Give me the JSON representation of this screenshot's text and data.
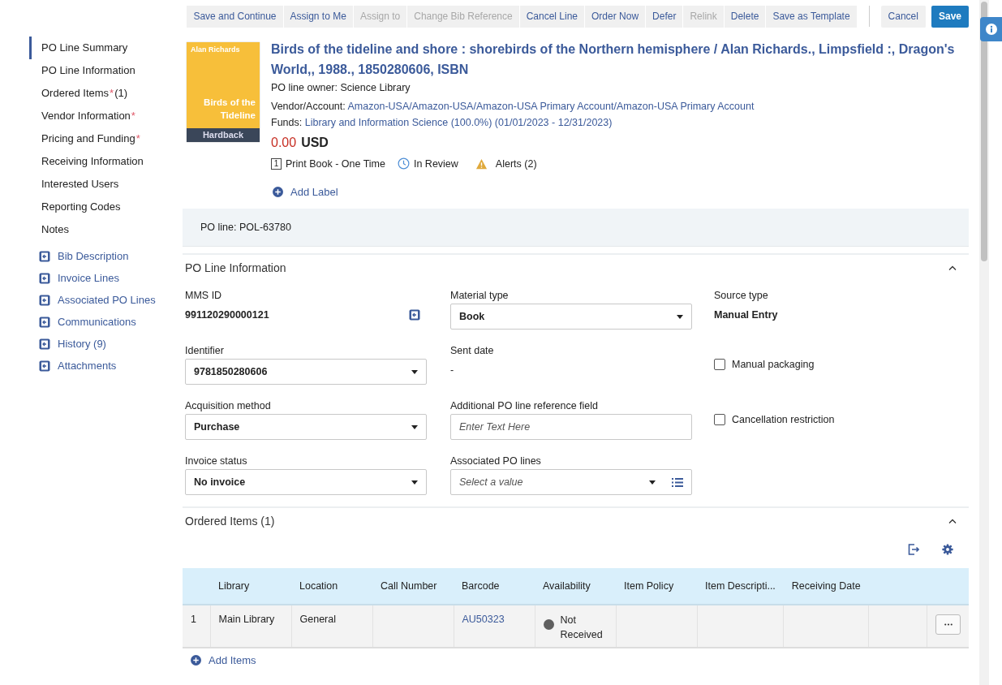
{
  "toolbar": {
    "buttons": [
      {
        "label": "Save and Continue",
        "disabled": false
      },
      {
        "label": "Assign to Me",
        "disabled": false
      },
      {
        "label": "Assign to",
        "disabled": true
      },
      {
        "label": "Change Bib Reference",
        "disabled": true
      },
      {
        "label": "Cancel Line",
        "disabled": false
      },
      {
        "label": "Order Now",
        "disabled": false
      },
      {
        "label": "Defer",
        "disabled": false
      },
      {
        "label": "Relink",
        "disabled": true
      },
      {
        "label": "Delete",
        "disabled": false
      },
      {
        "label": "Save as Template",
        "disabled": false
      }
    ],
    "cancel": "Cancel",
    "save": "Save"
  },
  "nav": {
    "sections": [
      {
        "label": "PO Line Summary",
        "selected": true
      },
      {
        "label": "PO Line Information",
        "selected": false
      },
      {
        "label": "Ordered Items",
        "required": "*",
        "count": "(1)",
        "selected": false
      },
      {
        "label": "Vendor Information",
        "required": "*",
        "selected": false
      },
      {
        "label": "Pricing and Funding",
        "required": "*",
        "selected": false
      },
      {
        "label": "Receiving Information",
        "selected": false
      },
      {
        "label": "Interested Users",
        "selected": false
      },
      {
        "label": "Reporting Codes",
        "selected": false
      },
      {
        "label": "Notes",
        "selected": false
      }
    ],
    "links": [
      "Bib Description",
      "Invoice Lines",
      "Associated PO Lines",
      "Communications",
      "History (9)",
      "Attachments"
    ]
  },
  "record": {
    "cover": {
      "author": "Alan Richards",
      "title": "Birds of the Tideline",
      "format": "Hardback"
    },
    "title": "Birds of the tideline and shore : shorebirds of the Northern hemisphere / Alan Richards., Limpsfield :, Dragon's World,, 1988., 1850280606, ISBN",
    "owner_label": "PO line owner:",
    "owner": "Science Library",
    "vendor_label": "Vendor/Account:",
    "vendor": "Amazon-USA/Amazon-USA/Amazon-USA Primary Account/Amazon-USA Primary Account",
    "funds_label": "Funds:",
    "funds": "Library and Information Science (100.0%) (01/01/2023 - 12/31/2023)",
    "price": "0.00",
    "currency": "USD",
    "type_number": "1",
    "type": "Print Book - One Time",
    "status": "In Review",
    "alerts": "Alerts (2)",
    "add_label": "Add Label"
  },
  "po_line": "PO line: POL-63780",
  "po_info": {
    "title": "PO Line Information",
    "expanded": true,
    "rows": [
      [
        {
          "kind": "text",
          "label": "MMS ID",
          "value": "991120290000121",
          "link": true
        },
        {
          "kind": "select",
          "label": "Material type",
          "value": "Book"
        },
        {
          "kind": "text",
          "label": "Source type",
          "value": "Manual Entry"
        }
      ],
      [
        {
          "kind": "select",
          "label": "Identifier",
          "value": "9781850280606"
        },
        {
          "kind": "text",
          "label": "Sent date",
          "value": "-"
        },
        {
          "kind": "checkbox",
          "label": "Manual packaging",
          "checked": false
        }
      ],
      [
        {
          "kind": "select",
          "label": "Acquisition method",
          "value": "Purchase"
        },
        {
          "kind": "input",
          "label": "Additional PO line reference field",
          "placeholder": "Enter Text Here"
        },
        {
          "kind": "checkbox",
          "label": "Cancellation restriction",
          "checked": false
        }
      ],
      [
        {
          "kind": "select",
          "label": "Invoice status",
          "value": "No invoice"
        },
        {
          "kind": "select",
          "label": "Associated PO lines",
          "placeholder": "Select a value",
          "list": true
        }
      ]
    ]
  },
  "ordered_items": {
    "title": "Ordered Items (1)",
    "expanded": true,
    "columns": [
      "Library",
      "Location",
      "Call Number",
      "Barcode",
      "Availability",
      "Item Policy",
      "Item Descripti...",
      "Receiving Date"
    ],
    "rows": [
      {
        "index": "1",
        "library": "Main Library",
        "location": "General",
        "barcode": "AU50323",
        "availability": "Not Received",
        "color": "#5f5f5f"
      }
    ],
    "add": "Add Items"
  }
}
